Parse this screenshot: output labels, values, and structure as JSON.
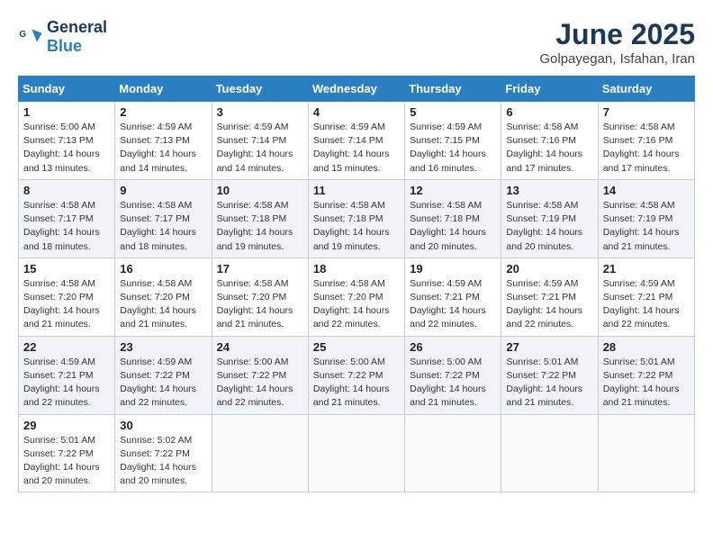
{
  "logo": {
    "text_general": "General",
    "text_blue": "Blue"
  },
  "title": {
    "month": "June 2025",
    "location": "Golpayegan, Isfahan, Iran"
  },
  "days_of_week": [
    "Sunday",
    "Monday",
    "Tuesday",
    "Wednesday",
    "Thursday",
    "Friday",
    "Saturday"
  ],
  "weeks": [
    [
      {
        "day": "1",
        "sunrise": "5:00 AM",
        "sunset": "7:13 PM",
        "daylight": "14 hours and 13 minutes."
      },
      {
        "day": "2",
        "sunrise": "4:59 AM",
        "sunset": "7:13 PM",
        "daylight": "14 hours and 14 minutes."
      },
      {
        "day": "3",
        "sunrise": "4:59 AM",
        "sunset": "7:14 PM",
        "daylight": "14 hours and 14 minutes."
      },
      {
        "day": "4",
        "sunrise": "4:59 AM",
        "sunset": "7:14 PM",
        "daylight": "14 hours and 15 minutes."
      },
      {
        "day": "5",
        "sunrise": "4:59 AM",
        "sunset": "7:15 PM",
        "daylight": "14 hours and 16 minutes."
      },
      {
        "day": "6",
        "sunrise": "4:58 AM",
        "sunset": "7:16 PM",
        "daylight": "14 hours and 17 minutes."
      },
      {
        "day": "7",
        "sunrise": "4:58 AM",
        "sunset": "7:16 PM",
        "daylight": "14 hours and 17 minutes."
      }
    ],
    [
      {
        "day": "8",
        "sunrise": "4:58 AM",
        "sunset": "7:17 PM",
        "daylight": "14 hours and 18 minutes."
      },
      {
        "day": "9",
        "sunrise": "4:58 AM",
        "sunset": "7:17 PM",
        "daylight": "14 hours and 18 minutes."
      },
      {
        "day": "10",
        "sunrise": "4:58 AM",
        "sunset": "7:18 PM",
        "daylight": "14 hours and 19 minutes."
      },
      {
        "day": "11",
        "sunrise": "4:58 AM",
        "sunset": "7:18 PM",
        "daylight": "14 hours and 19 minutes."
      },
      {
        "day": "12",
        "sunrise": "4:58 AM",
        "sunset": "7:18 PM",
        "daylight": "14 hours and 20 minutes."
      },
      {
        "day": "13",
        "sunrise": "4:58 AM",
        "sunset": "7:19 PM",
        "daylight": "14 hours and 20 minutes."
      },
      {
        "day": "14",
        "sunrise": "4:58 AM",
        "sunset": "7:19 PM",
        "daylight": "14 hours and 21 minutes."
      }
    ],
    [
      {
        "day": "15",
        "sunrise": "4:58 AM",
        "sunset": "7:20 PM",
        "daylight": "14 hours and 21 minutes."
      },
      {
        "day": "16",
        "sunrise": "4:58 AM",
        "sunset": "7:20 PM",
        "daylight": "14 hours and 21 minutes."
      },
      {
        "day": "17",
        "sunrise": "4:58 AM",
        "sunset": "7:20 PM",
        "daylight": "14 hours and 21 minutes."
      },
      {
        "day": "18",
        "sunrise": "4:58 AM",
        "sunset": "7:20 PM",
        "daylight": "14 hours and 22 minutes."
      },
      {
        "day": "19",
        "sunrise": "4:59 AM",
        "sunset": "7:21 PM",
        "daylight": "14 hours and 22 minutes."
      },
      {
        "day": "20",
        "sunrise": "4:59 AM",
        "sunset": "7:21 PM",
        "daylight": "14 hours and 22 minutes."
      },
      {
        "day": "21",
        "sunrise": "4:59 AM",
        "sunset": "7:21 PM",
        "daylight": "14 hours and 22 minutes."
      }
    ],
    [
      {
        "day": "22",
        "sunrise": "4:59 AM",
        "sunset": "7:21 PM",
        "daylight": "14 hours and 22 minutes."
      },
      {
        "day": "23",
        "sunrise": "4:59 AM",
        "sunset": "7:22 PM",
        "daylight": "14 hours and 22 minutes."
      },
      {
        "day": "24",
        "sunrise": "5:00 AM",
        "sunset": "7:22 PM",
        "daylight": "14 hours and 22 minutes."
      },
      {
        "day": "25",
        "sunrise": "5:00 AM",
        "sunset": "7:22 PM",
        "daylight": "14 hours and 21 minutes."
      },
      {
        "day": "26",
        "sunrise": "5:00 AM",
        "sunset": "7:22 PM",
        "daylight": "14 hours and 21 minutes."
      },
      {
        "day": "27",
        "sunrise": "5:01 AM",
        "sunset": "7:22 PM",
        "daylight": "14 hours and 21 minutes."
      },
      {
        "day": "28",
        "sunrise": "5:01 AM",
        "sunset": "7:22 PM",
        "daylight": "14 hours and 21 minutes."
      }
    ],
    [
      {
        "day": "29",
        "sunrise": "5:01 AM",
        "sunset": "7:22 PM",
        "daylight": "14 hours and 20 minutes."
      },
      {
        "day": "30",
        "sunrise": "5:02 AM",
        "sunset": "7:22 PM",
        "daylight": "14 hours and 20 minutes."
      },
      null,
      null,
      null,
      null,
      null
    ]
  ]
}
